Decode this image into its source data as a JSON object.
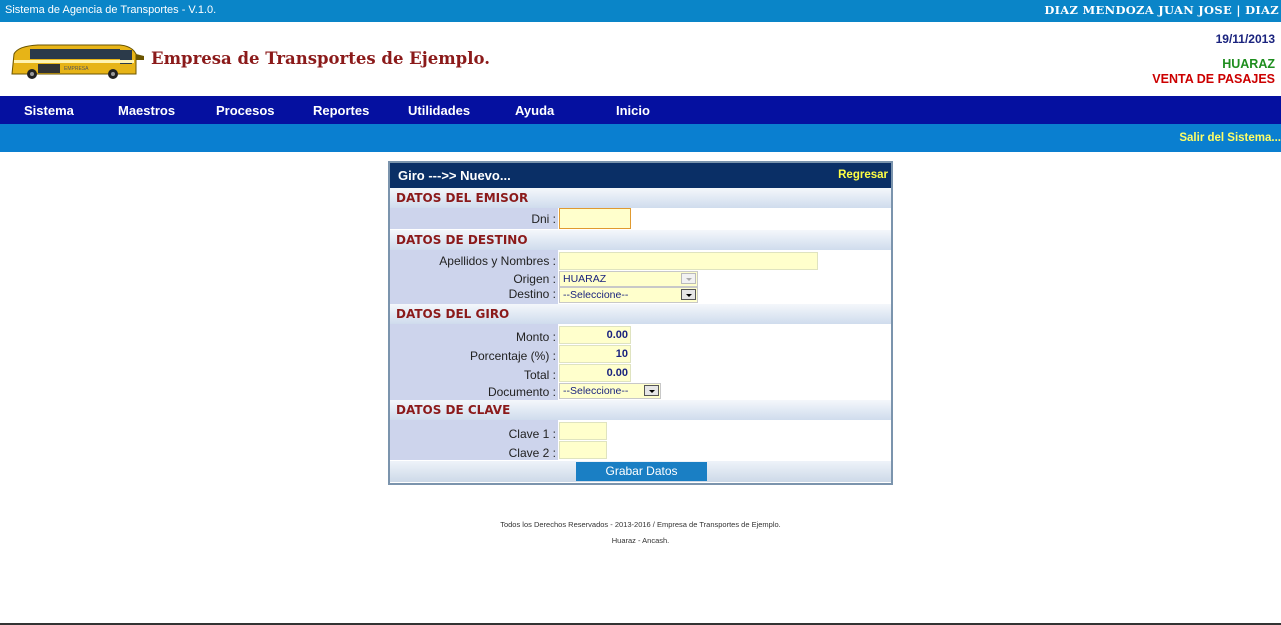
{
  "topbar": {
    "system_name": "Sistema de Agencia de Transportes - V.1.0.",
    "user": "DIAZ MENDOZA JUAN JOSE | DIAZ"
  },
  "header": {
    "company": "Empresa de Transportes de Ejemplo.",
    "date": "19/11/2013",
    "city": "HUARAZ",
    "module": "VENTA DE PASAJES"
  },
  "menu": [
    "Sistema",
    "Maestros",
    "Procesos",
    "Reportes",
    "Utilidades",
    "Ayuda",
    "Inicio"
  ],
  "subbar": {
    "exit": "Salir del Sistema..."
  },
  "form": {
    "title": "Giro --->> Nuevo...",
    "back": "Regresar",
    "sec_emisor": "DATOS DEL EMISOR",
    "dni_label": "Dni :",
    "dni_value": "",
    "sec_destino": "DATOS DE DESTINO",
    "nombres_label": "Apellidos y Nombres :",
    "nombres_value": "",
    "origen_label": "Origen :",
    "origen_value": "HUARAZ",
    "destino_label": "Destino :",
    "destino_value": "--Seleccione--",
    "sec_giro": "DATOS DEL GIRO",
    "monto_label": "Monto :",
    "monto_value": "0.00",
    "porcentaje_label": "Porcentaje (%) :",
    "porcentaje_value": "10",
    "total_label": "Total :",
    "total_value": "0.00",
    "documento_label": "Documento :",
    "documento_value": "--Seleccione--",
    "sec_clave": "DATOS DE CLAVE",
    "clave1_label": "Clave 1 :",
    "clave2_label": "Clave 2 :",
    "submit": "Grabar Datos"
  },
  "footer": {
    "line1": "Todos los Derechos Reservados - 2013-2016 / Empresa de Transportes de Ejemplo.",
    "line2": "Huaraz - Ancash."
  },
  "colors": {
    "topbar": "#0a85c8",
    "menubar": "#0510a0",
    "subbar": "#0a7fd0",
    "panel_title": "#0a2f66",
    "section_text": "#8b1a1a",
    "input_bg": "#ffffcc",
    "button": "#1a7fc4"
  },
  "icons": {
    "logo": "bus-icon"
  }
}
